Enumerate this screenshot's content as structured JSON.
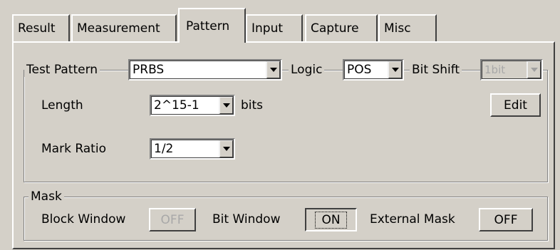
{
  "tabs": [
    {
      "label": "Result"
    },
    {
      "label": "Measurement"
    },
    {
      "label": "Pattern",
      "active": true
    },
    {
      "label": "Input"
    },
    {
      "label": "Capture"
    },
    {
      "label": "Misc"
    }
  ],
  "test_pattern": {
    "group_label": "Test Pattern",
    "pattern_value": "PRBS",
    "logic_label": "Logic",
    "logic_value": "POS",
    "bit_shift_label": "Bit Shift",
    "bit_shift_value": "1bit",
    "length_label": "Length",
    "length_value": "2^15-1",
    "length_unit": "bits",
    "edit_label": "Edit",
    "mark_ratio_label": "Mark Ratio",
    "mark_ratio_value": "1/2"
  },
  "mask": {
    "group_label": "Mask",
    "block_window_label": "Block Window",
    "block_window_value": "OFF",
    "bit_window_label": "Bit Window",
    "bit_window_value": "ON",
    "external_mask_label": "External Mask",
    "external_mask_value": "OFF"
  },
  "icons": {
    "dropdown": "chevron-down-icon"
  }
}
